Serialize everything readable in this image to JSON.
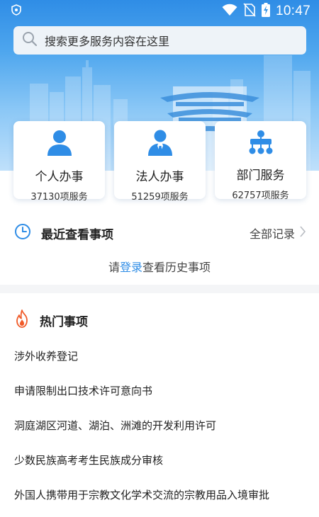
{
  "status_bar": {
    "time": "10:47"
  },
  "search": {
    "placeholder": "搜索更多服务内容在这里"
  },
  "services": [
    {
      "title": "个人办事",
      "count": "37130项服务"
    },
    {
      "title": "法人办事",
      "count": "51259项服务"
    },
    {
      "title": "部门服务",
      "count": "62757项服务"
    }
  ],
  "recent": {
    "title": "最近查看事项",
    "all_records": "全部记录",
    "hint_prefix": "请",
    "hint_link": "登录",
    "hint_suffix": "查看历史事项"
  },
  "hot": {
    "title": "热门事项",
    "items": [
      "涉外收养登记",
      "申请限制出口技术许可意向书",
      "洞庭湖区河道、湖泊、洲滩的开发利用许可",
      "少数民族高考考生民族成分审核",
      "外国人携带用于宗教文化学术交流的宗教用品入境审批"
    ]
  },
  "colors": {
    "accent": "#2f8de6",
    "header_top": "#2f8de6",
    "header_bottom": "#bfe0fb",
    "divider": "#f4f5f7",
    "hot_icon": "#f05a28"
  }
}
